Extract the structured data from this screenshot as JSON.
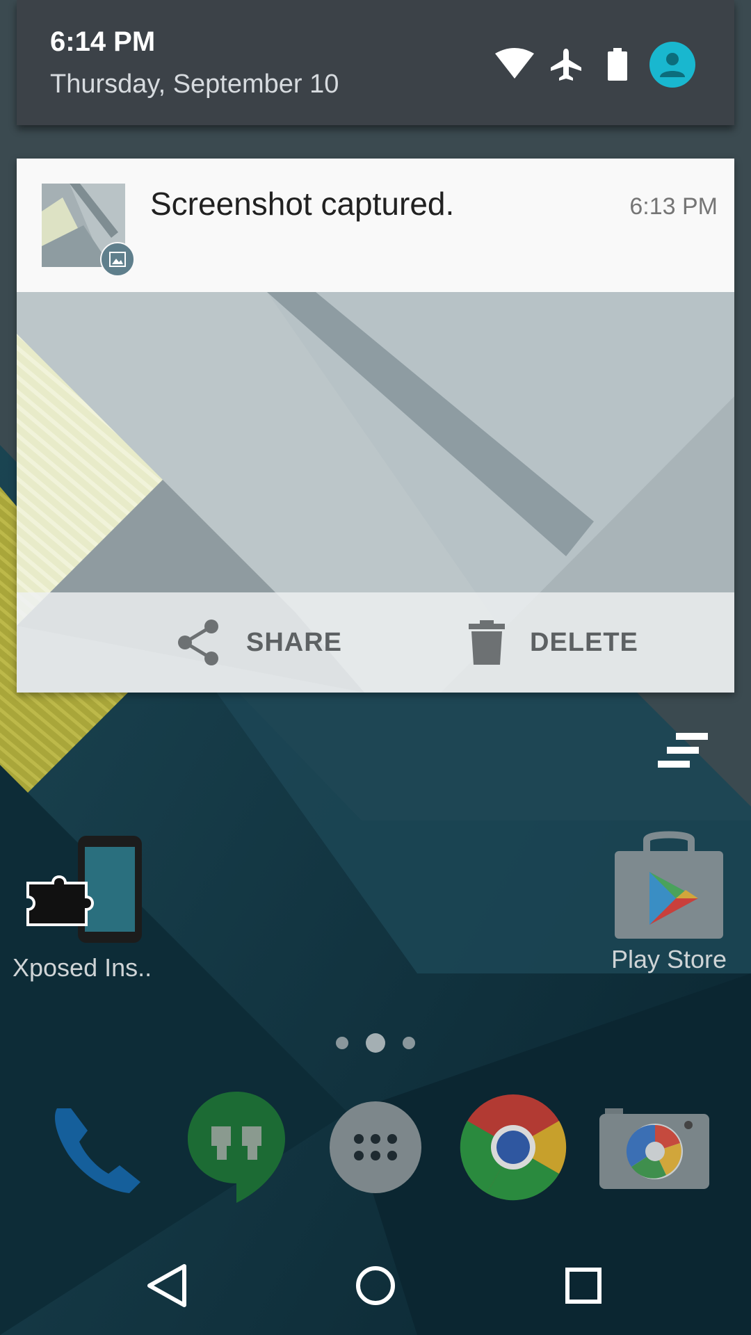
{
  "status_bar": {
    "time": "6:14 PM",
    "date": "Thursday, September 10",
    "icons": [
      "wifi-icon",
      "airplane-mode-icon",
      "battery-icon",
      "user-avatar-icon"
    ]
  },
  "notification": {
    "title": "Screenshot captured.",
    "time": "6:13 PM",
    "badge_icon": "image-icon",
    "actions": [
      {
        "label": "SHARE",
        "icon": "share-icon"
      },
      {
        "label": "DELETE",
        "icon": "trash-icon"
      }
    ]
  },
  "home": {
    "apps": [
      {
        "label": "Xposed Ins..",
        "icon": "xposed-installer-icon"
      },
      {
        "label": "Play Store",
        "icon": "play-store-icon"
      }
    ],
    "dock": [
      {
        "icon": "phone-icon"
      },
      {
        "icon": "hangouts-icon"
      },
      {
        "icon": "app-drawer-icon"
      },
      {
        "icon": "chrome-icon"
      },
      {
        "icon": "camera-icon"
      }
    ],
    "page_indicator": {
      "pages": 3,
      "current": 2
    }
  },
  "navbar": {
    "buttons": [
      "back-icon",
      "home-icon",
      "recents-icon"
    ]
  },
  "colors": {
    "accent": "#19b7cf",
    "header_bg": "#3c4248",
    "wallpaper_dark": "#0f3340"
  }
}
